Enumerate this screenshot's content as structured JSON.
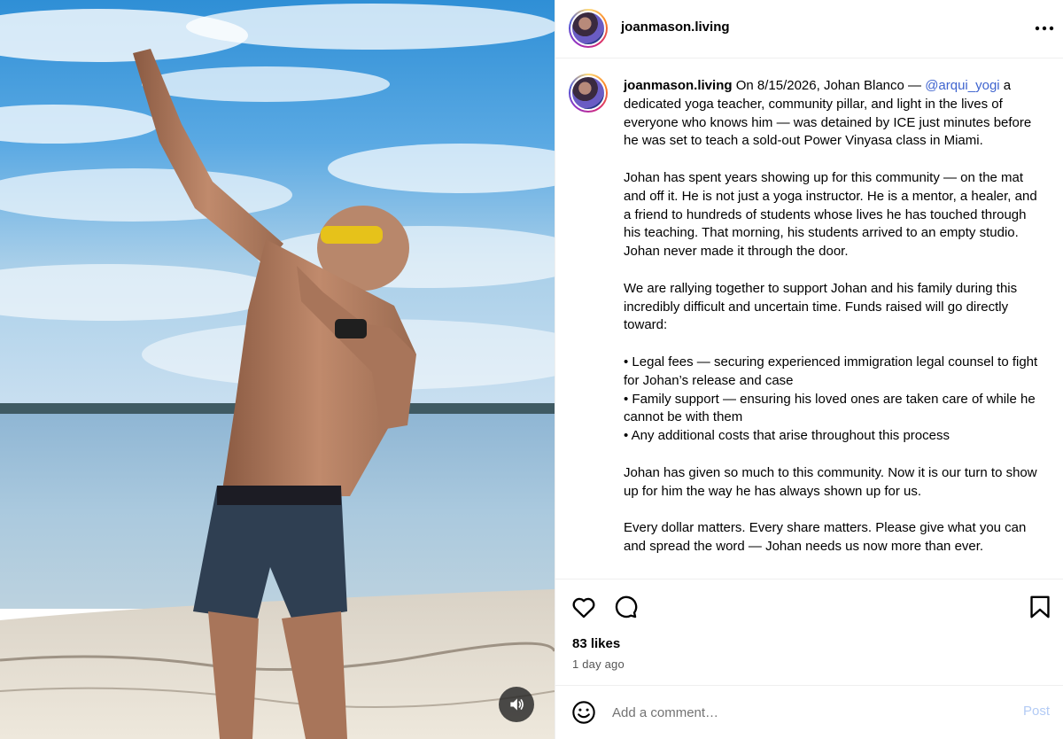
{
  "post": {
    "author": "joanmason.living",
    "likes": "83 likes",
    "age": "1 day ago"
  },
  "caption": {
    "username": "joanmason.living",
    "p1_before": " On 8/15/2026, Johan Blanco — ",
    "mention": "@arqui_yogi",
    "p1_after": " a dedicated yoga teacher, community pillar, and light in the lives of everyone who knows him — was detained by ICE just minutes before he was set to teach a sold-out Power Vinyasa class in Miami.",
    "p2": "Johan has spent years showing up for this community — on the mat and off it. He is not just a yoga instructor. He is a mentor, a healer, and a friend to hundreds of students whose lives he has touched through his teaching. That morning, his students arrived to an empty studio. Johan never made it through the door.",
    "p3": "We are rallying together to support Johan and his family during this incredibly difficult and uncertain time. Funds raised will go directly toward:",
    "bullets": [
      "• Legal fees — securing experienced immigration legal counsel to fight for Johan’s release and case",
      "• Family support — ensuring his loved ones are taken care of while he cannot be with them",
      "• Any additional costs that arise throughout this process"
    ],
    "p4": "Johan has given so much to this community. Now it is our turn to show up for him the way he has always shown up for us.",
    "p5": "Every dollar matters. Every share matters. Please give what you can and spread the word — Johan needs us now more than ever."
  },
  "comment": {
    "placeholder": "Add a comment…",
    "post_label": "Post"
  },
  "icons": {
    "more": "more-options-icon",
    "like": "heart-icon",
    "comment": "comment-icon",
    "save": "bookmark-icon",
    "emoji": "emoji-icon",
    "sound": "speaker-icon"
  },
  "colors": {
    "mention": "#3f64cf",
    "post_button": "#b3cbf5",
    "secondary_text": "#737373"
  }
}
